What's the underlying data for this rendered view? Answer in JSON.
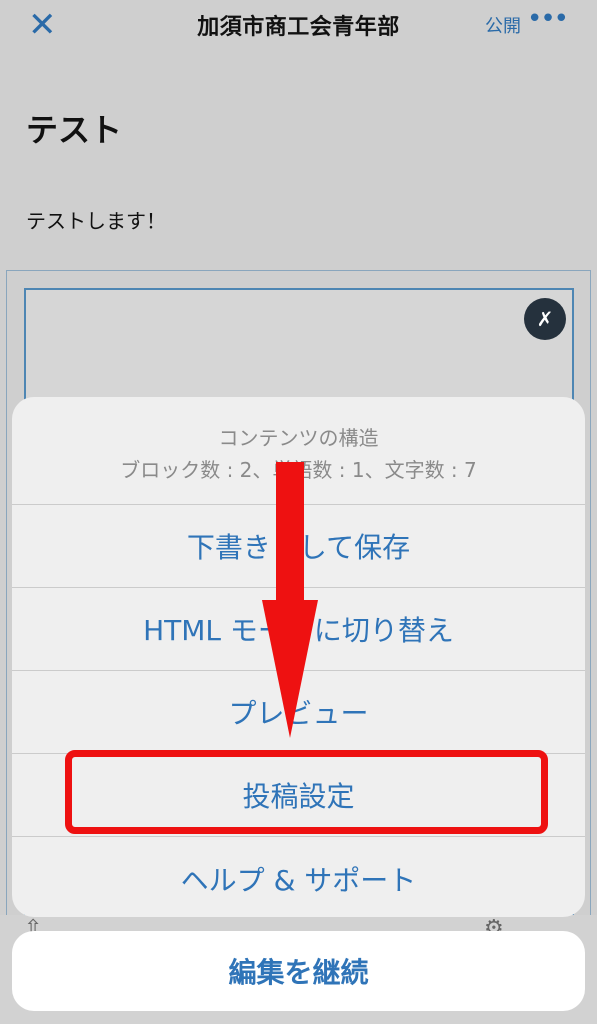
{
  "header": {
    "close_icon": "close-icon",
    "site_title": "加須市商工会青年部",
    "publish_label": "公開",
    "more_icon": "more-icon",
    "accent_color": "#2f74b8"
  },
  "post": {
    "title": "テスト",
    "body": "テストします！"
  },
  "image_block": {
    "tools_icon": "wrench-screwdriver-icon"
  },
  "action_sheet": {
    "title": "コンテンツの構造",
    "stats": "ブロック数 : 2、単語数 : 1、文字数 : 7",
    "items": [
      {
        "label": "下書きとして保存"
      },
      {
        "label": "HTML モードに切り替え"
      },
      {
        "label": "プレビュー"
      },
      {
        "label": "投稿設定"
      },
      {
        "label": "ヘルプ & サポート"
      }
    ],
    "cancel_label": "編集を継続"
  },
  "annotation": {
    "arrow_color": "#ee1111",
    "highlight_color": "#ee1111",
    "highlighted_item": "投稿設定"
  }
}
